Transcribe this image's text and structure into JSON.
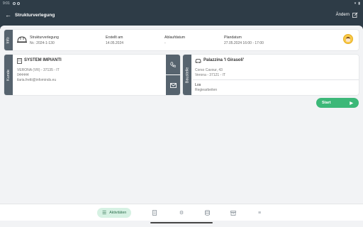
{
  "statusbar": {
    "time": "9:01"
  },
  "appbar": {
    "title": "Strukturverlegung",
    "edit_label": "Ändern"
  },
  "info": {
    "tag": "Info",
    "type_label": "Strukturverlegung",
    "number": "Nr.: 2024-1-130",
    "created_label": "Erstellt am",
    "created_value": "14.05.2024",
    "expiry_label": "Ablaufdatum",
    "expiry_value": "-",
    "planned_label": "Plandatum",
    "planned_value": "27.05.2024 16:00 - 17:00"
  },
  "kunde": {
    "tag": "Kunde",
    "name": "SYSTEM IMPIANTI",
    "address": "VERONA (VR) - 37135 - IT",
    "phone": "044444",
    "email": "ilaria.fretti@infominds.eu"
  },
  "baustelle": {
    "tag": "Baustelle",
    "name": "Palazzina 'I Girasoli'",
    "street": "Corso Cavour, 43",
    "city": "Verona - 37121 - IT",
    "lot_label": "Los",
    "lot_value": "Regiearbeiten"
  },
  "start_button": {
    "label": "Start"
  },
  "bottomnav": {
    "active_label": "Aktivitäten"
  }
}
